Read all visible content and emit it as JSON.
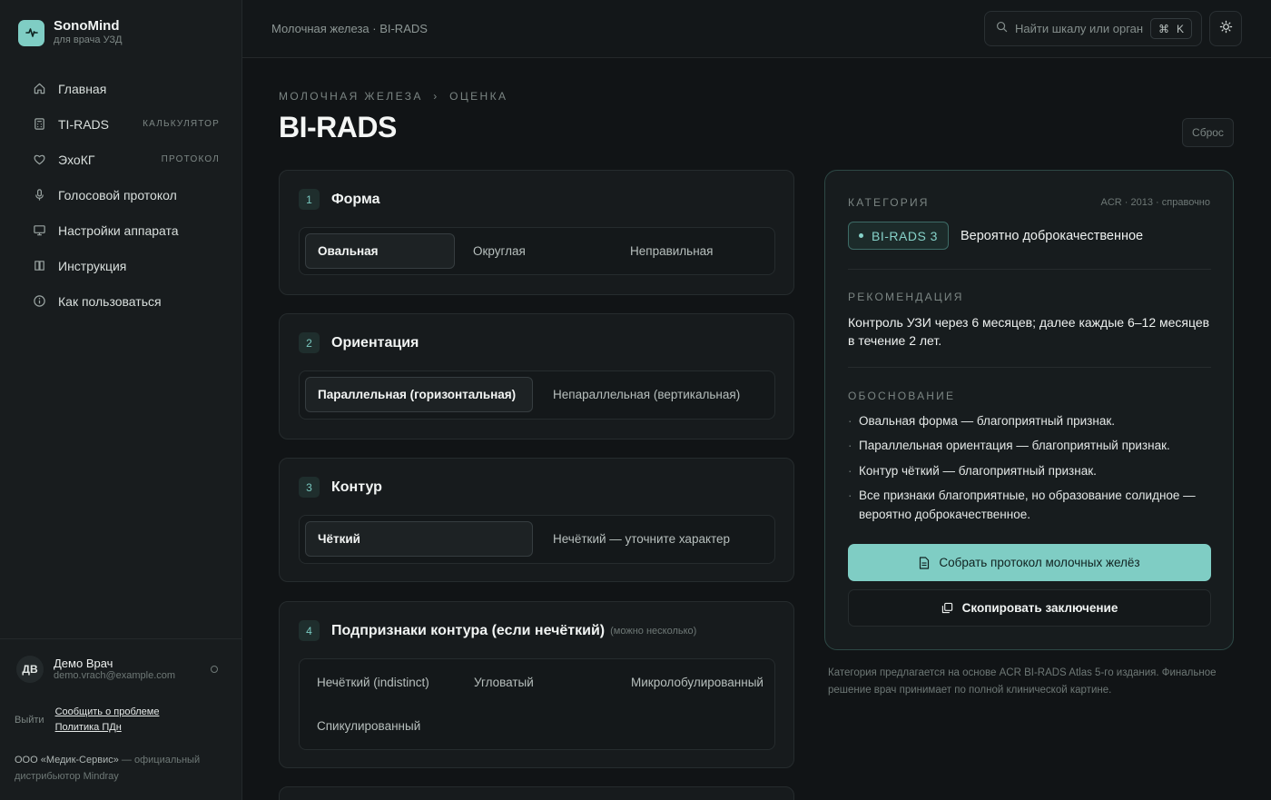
{
  "brand": {
    "name": "SonoMind",
    "subtitle": "для врача УЗД"
  },
  "sidebar": {
    "items": [
      {
        "label": "Главная",
        "tag": ""
      },
      {
        "label": "TI-RADS",
        "tag": "калькулятор"
      },
      {
        "label": "ЭхоКГ",
        "tag": "протокол"
      },
      {
        "label": "Голосовой протокол",
        "tag": ""
      },
      {
        "label": "Настройки аппарата",
        "tag": ""
      },
      {
        "label": "Инструкция",
        "tag": ""
      },
      {
        "label": "Как пользоваться",
        "tag": ""
      }
    ],
    "user": {
      "initials": "ДВ",
      "name": "Демо Врач",
      "email": "demo.vrach@example.com"
    },
    "logout": "Выйти",
    "report_link": "Сообщить о проблеме",
    "privacy_link": "Политика ПДн",
    "company_name": "ООО «Медик-Сервис»",
    "company_rest": " — официальный дистрибьютор Mindray"
  },
  "topbar": {
    "breadcrumb": "Молочная железа · BI-RADS",
    "search_placeholder": "Найти шкалу или орган",
    "shortcut_symbol": "⌘",
    "shortcut_key": "K"
  },
  "page": {
    "eyebrow": "Молочная железа  ›  Оценка",
    "title": "BI-RADS",
    "reset": "Сброс"
  },
  "cards": [
    {
      "num": "1",
      "title": "Форма",
      "hint": "",
      "options": [
        "Овальная",
        "Округлая",
        "Неправильная"
      ],
      "selected": 0
    },
    {
      "num": "2",
      "title": "Ориентация",
      "hint": "",
      "options": [
        "Параллельная (горизонтальная)",
        "Непараллельная (вертикальная)"
      ],
      "selected": 0
    },
    {
      "num": "3",
      "title": "Контур",
      "hint": "",
      "options": [
        "Чёткий",
        "Нечёткий — уточните характер"
      ],
      "selected": 0
    },
    {
      "num": "4",
      "title": "Подпризнаки контура (если нечёткий)",
      "hint": "(можно несколько)",
      "options": [
        "Нечёткий (indistinct)",
        "Угловатый",
        "Микролобулированный",
        "Спикулированный"
      ],
      "selected": -1
    }
  ],
  "result": {
    "category_label": "Категория",
    "source": "ACR · 2013 · справочно",
    "badge": "BI-RADS 3",
    "verdict": "Вероятно доброкачественное",
    "recommendation_label": "Рекомендация",
    "recommendation": "Контроль УЗИ через 6 месяцев; далее каждые 6–12 месяцев в течение 2 лет.",
    "reasoning_label": "Обоснование",
    "reasons": [
      "Овальная форма — благоприятный признак.",
      "Параллельная ориентация — благоприятный признак.",
      "Контур чёткий — благоприятный признак.",
      "Все признаки благоприятные, но образование солидное — вероятно доброкачественное."
    ],
    "primary_button": "Собрать протокол молочных желёз",
    "secondary_button": "Скопировать заключение"
  },
  "footnote": "Категория предлагается на основе ACR BI-RADS Atlas 5-го издания. Финальное решение врач принимает по полной клинической картине.",
  "colors": {
    "accent": "#7fcdc4",
    "background": "#111416",
    "sidebar": "#181c1e",
    "card": "#171b1d"
  }
}
